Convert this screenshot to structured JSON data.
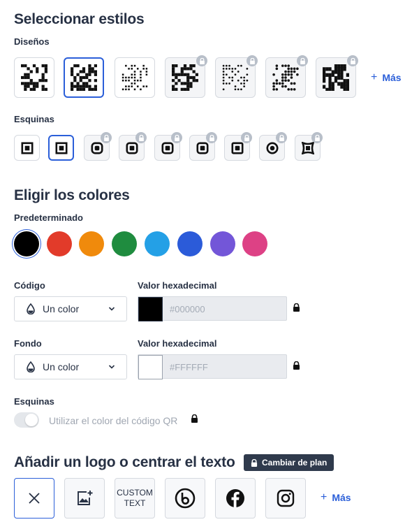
{
  "styles": {
    "title": "Seleccionar estilos",
    "designs_label": "Diseños",
    "corners_label": "Esquinas",
    "more_label": "Más"
  },
  "colors": {
    "title": "Eligir los colores",
    "preset_label": "Predeterminado",
    "swatches": [
      "#000000",
      "#e23b2a",
      "#f08a0c",
      "#1f8c3f",
      "#24a0e6",
      "#2b5bd9",
      "#7356d8",
      "#dd4185"
    ],
    "selected": "#000000",
    "code_label": "Código",
    "code_hex_label": "Valor hexadecimal",
    "code_select": "Un color",
    "code_hex_placeholder": "#000000",
    "code_swatch": "#000000",
    "bg_label": "Fondo",
    "bg_hex_label": "Valor hexadecimal",
    "bg_select": "Un color",
    "bg_hex_placeholder": "#FFFFFF",
    "bg_swatch": "#ffffff",
    "corners_label": "Esquinas",
    "corners_toggle_label": "Utilizar el color del código QR"
  },
  "logo": {
    "title": "Añadir un logo o centrar el texto",
    "plan_badge": "Cambiar de plan",
    "custom_text_line1": "CUSTOM",
    "custom_text_line2": "TEXT",
    "more_label": "Más"
  }
}
